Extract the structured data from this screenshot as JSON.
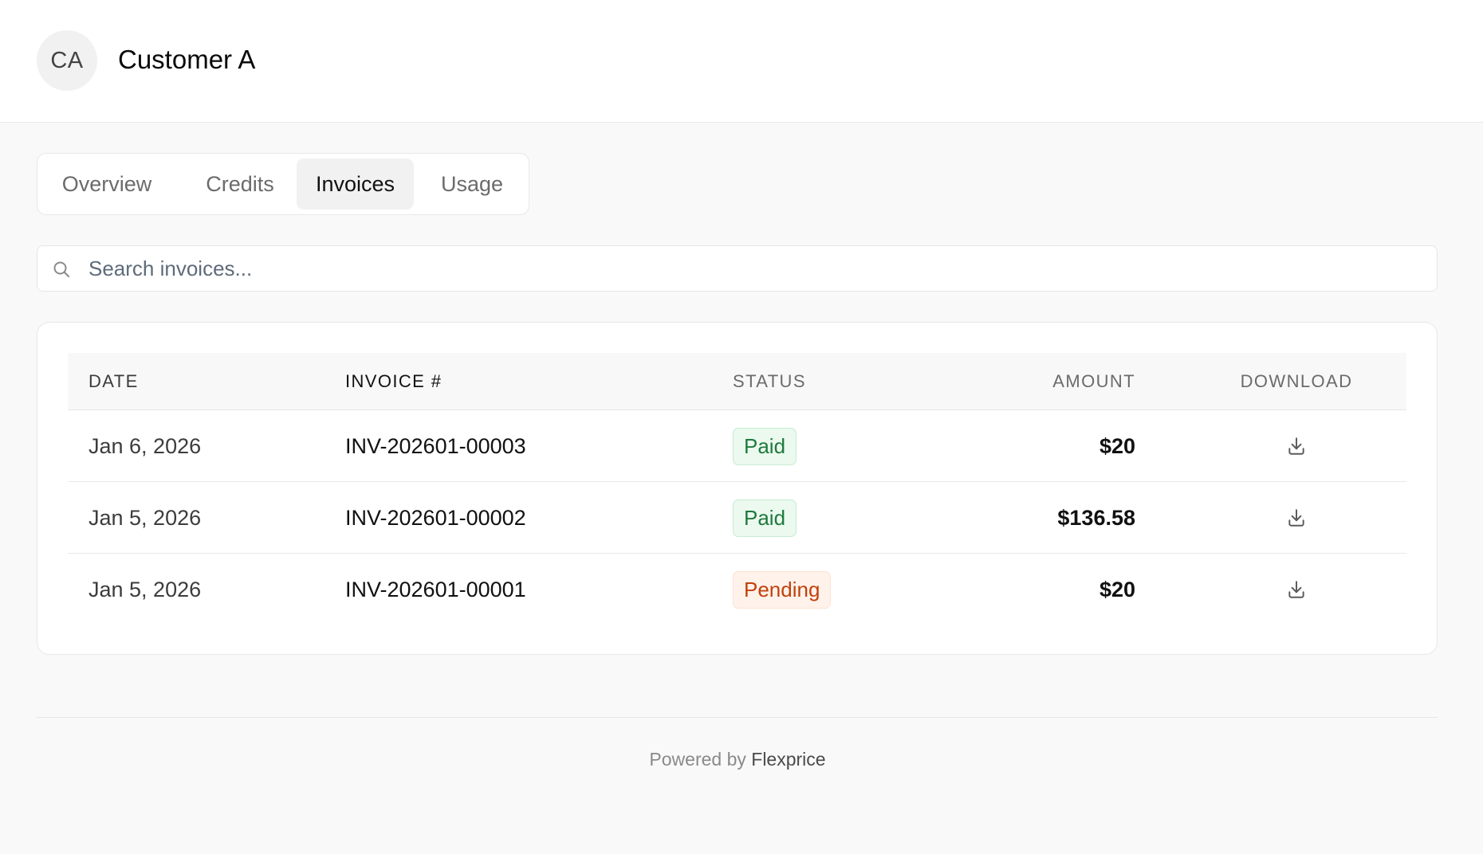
{
  "customer": {
    "initials": "CA",
    "name": "Customer A"
  },
  "tabs": [
    {
      "label": "Overview",
      "active": false
    },
    {
      "label": "Credits",
      "active": false
    },
    {
      "label": "Invoices",
      "active": true
    },
    {
      "label": "Usage",
      "active": false
    }
  ],
  "search": {
    "placeholder": "Search invoices...",
    "value": "",
    "icon": "search-icon"
  },
  "table": {
    "headers": {
      "date": "DATE",
      "invoice": "INVOICE #",
      "status": "STATUS",
      "amount": "AMOUNT",
      "download": "DOWNLOAD"
    },
    "rows": [
      {
        "date": "Jan 6, 2026",
        "invoice": "INV-202601-00003",
        "status": "Paid",
        "amount": "$20",
        "download_icon": "download-icon"
      },
      {
        "date": "Jan 5, 2026",
        "invoice": "INV-202601-00002",
        "status": "Paid",
        "amount": "$136.58",
        "download_icon": "download-icon"
      },
      {
        "date": "Jan 5, 2026",
        "invoice": "INV-202601-00001",
        "status": "Pending",
        "amount": "$20",
        "download_icon": "download-icon"
      }
    ]
  },
  "status_colors": {
    "Paid": "#1f7a3d",
    "Pending": "#c2410c"
  },
  "footer": {
    "prefix": "Powered by",
    "brand": "Flexprice"
  }
}
